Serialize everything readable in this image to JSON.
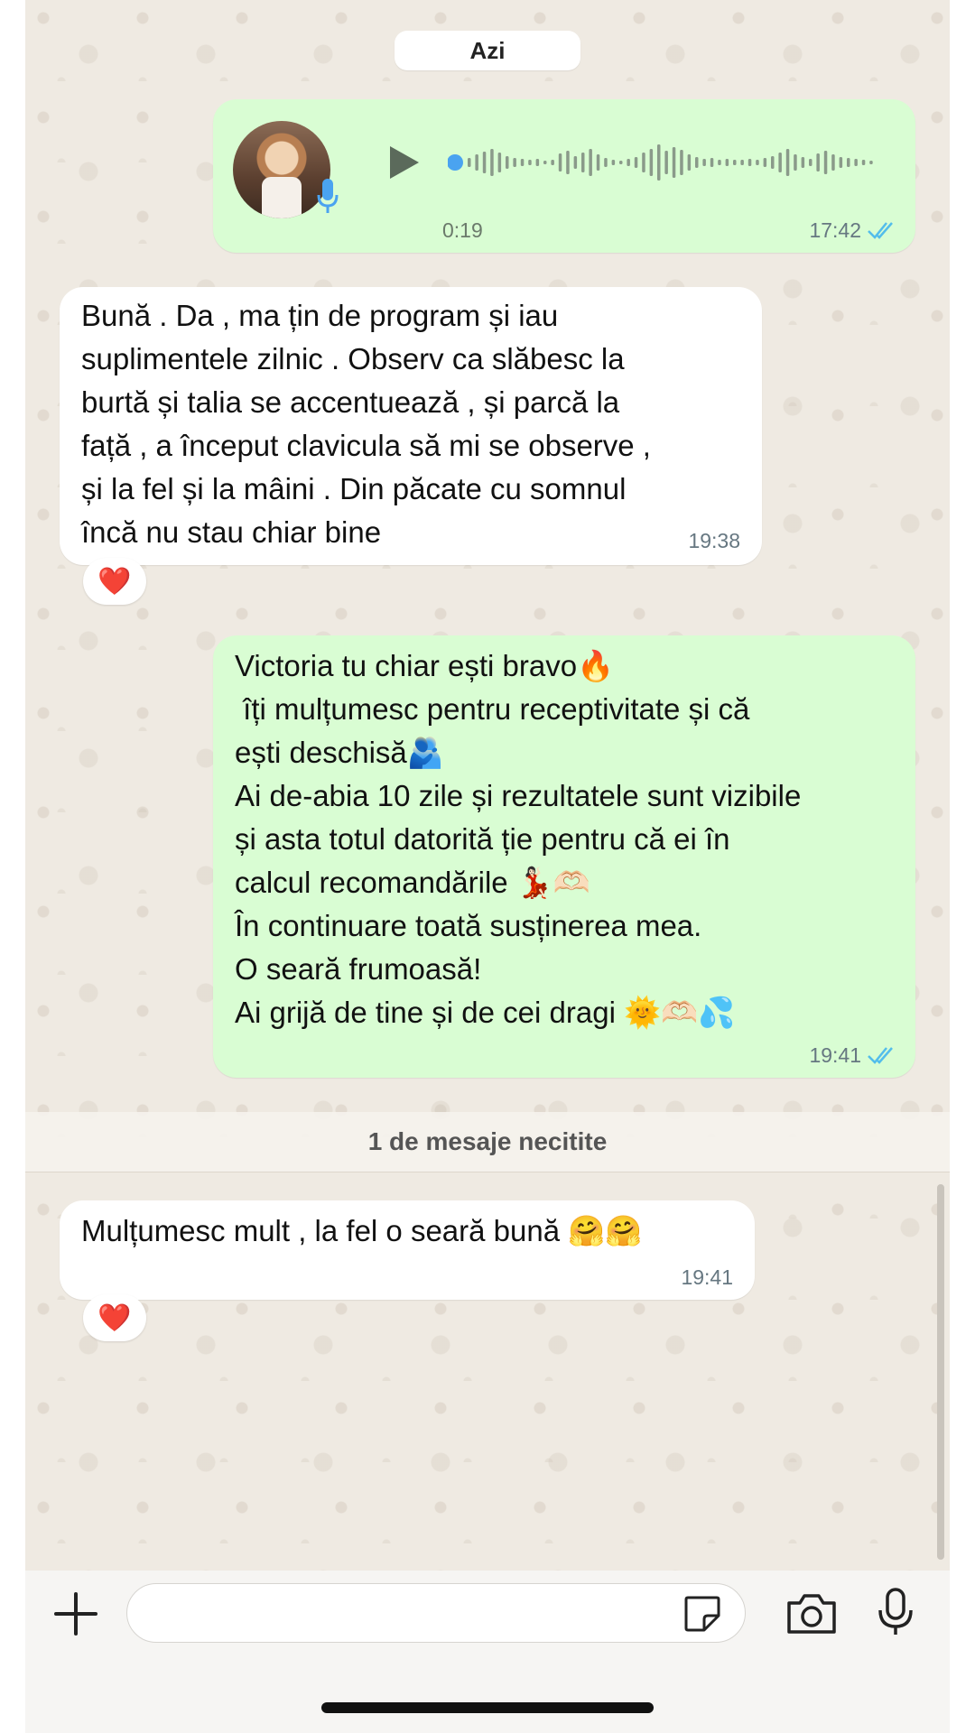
{
  "date_separator": "Azi",
  "voice_message": {
    "duration": "0:19",
    "time": "17:42",
    "status": "read"
  },
  "messages": [
    {
      "direction": "incoming",
      "text": "Bună . Da , ma țin de program și iau\nsuplimentele zilnic . Observ ca slăbesc la\nburtă și talia se accentuează , și parcă la\nfață , a început clavicula să mi se observe ,\nși la fel și la mâini . Din păcate cu somnul\nîncă nu stau chiar bine",
      "time": "19:38",
      "reaction": "❤️"
    },
    {
      "direction": "outgoing",
      "text": "Victoria tu chiar ești bravo🔥\n îți mulțumesc pentru receptivitate și că\nești deschisă🫂\nAi de-abia 10 zile și rezultatele sunt vizibile\nși asta totul datorită ție pentru că ei în\ncalcul recomandările 💃🏻🫶🏻\nÎn continuare toată susținerea mea.\nO seară frumoasă!\nAi grijă de tine și de cei dragi 🌞🫶🏻💦",
      "time": "19:41",
      "status": "read"
    },
    {
      "direction": "incoming",
      "text": "Mulțumesc mult , la fel o seară bună 🤗🤗",
      "time": "19:41",
      "reaction": "❤️"
    }
  ],
  "unread_banner": "1 de mesaje necitite",
  "composer": {
    "value": "",
    "placeholder": ""
  },
  "colors": {
    "outgoing_bubble": "#d9fdd3",
    "incoming_bubble": "#ffffff",
    "chat_background": "#efeae2",
    "read_ticks": "#53bdeb",
    "accent_blue": "#4aa3f0"
  },
  "icons": {
    "attach": "plus-icon",
    "sticker": "sticker-icon",
    "camera": "camera-icon",
    "voice": "microphone-icon",
    "play": "play-icon"
  }
}
